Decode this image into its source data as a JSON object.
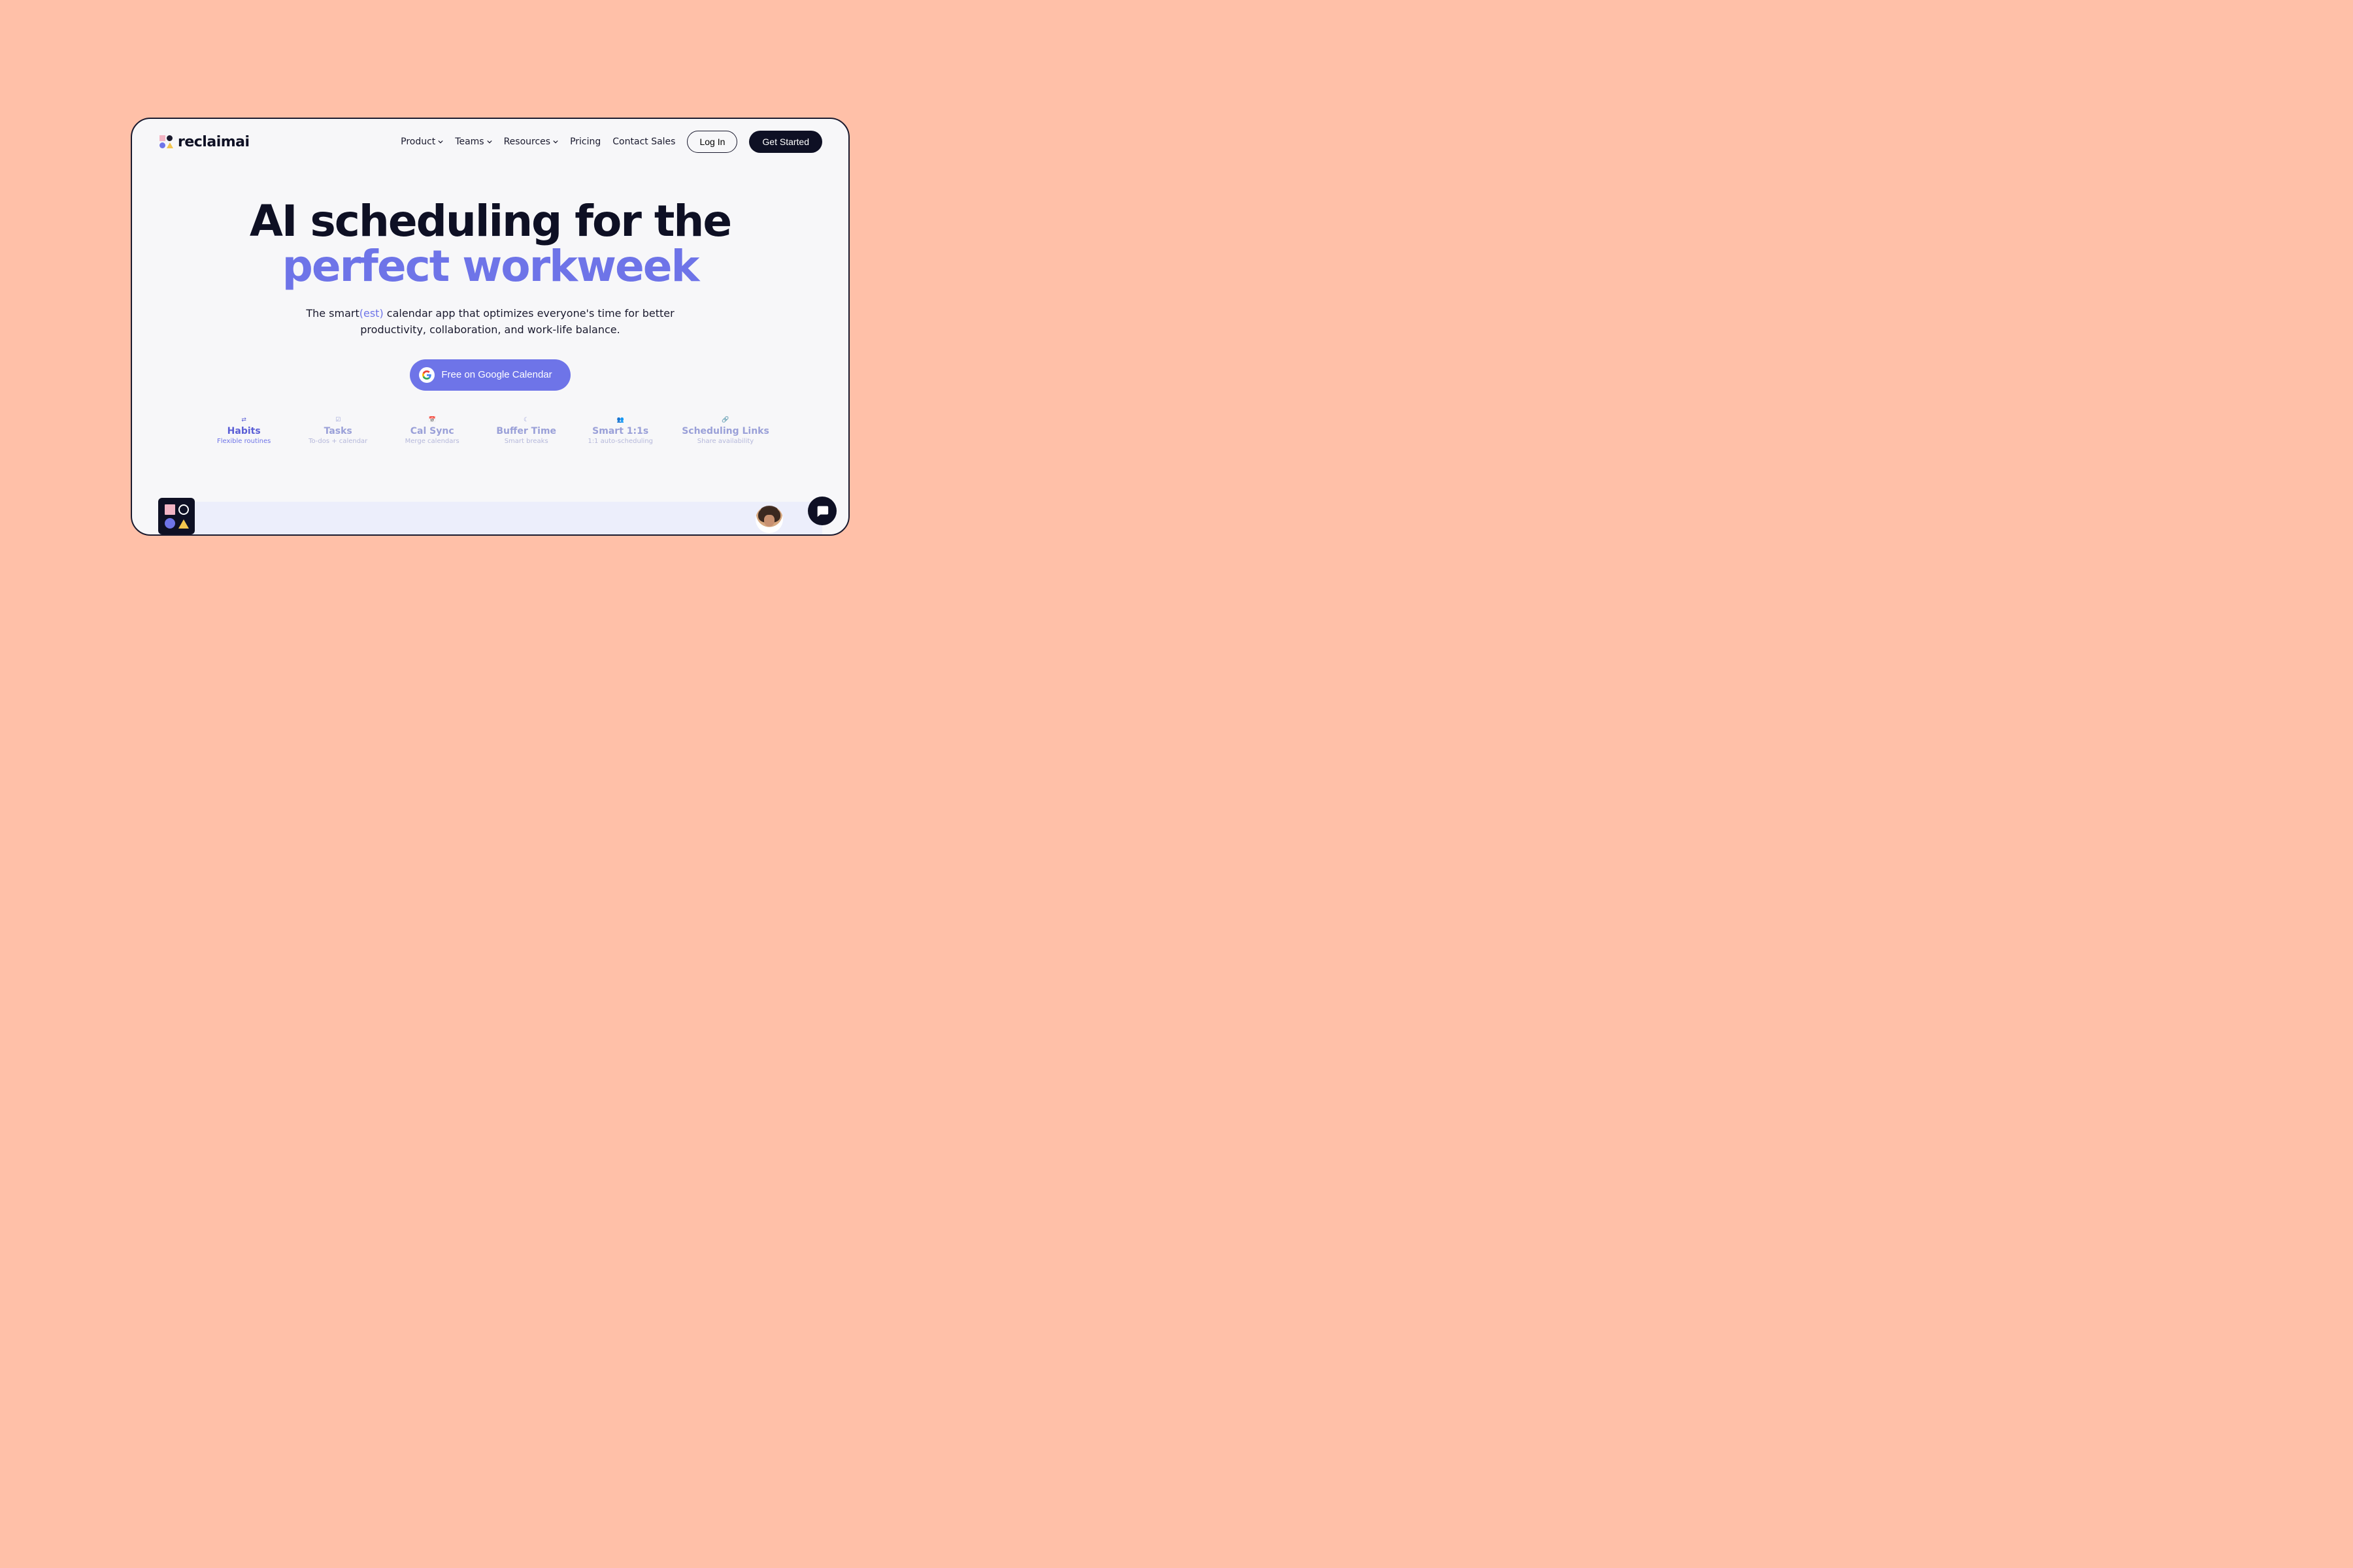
{
  "logo": {
    "text": "reclaimai"
  },
  "nav": {
    "items": [
      {
        "label": "Product",
        "has_dropdown": true
      },
      {
        "label": "Teams",
        "has_dropdown": true
      },
      {
        "label": "Resources",
        "has_dropdown": true
      },
      {
        "label": "Pricing",
        "has_dropdown": false
      },
      {
        "label": "Contact Sales",
        "has_dropdown": false
      }
    ],
    "login": "Log In",
    "get_started": "Get Started"
  },
  "hero": {
    "line1": "AI scheduling for the",
    "line2": "perfect workweek",
    "sub_pre": "The smart",
    "sub_est": "(est)",
    "sub_post": " calendar app that optimizes everyone's time for better",
    "sub_line2": "productivity, collaboration, and work-life balance."
  },
  "cta": {
    "label": "Free on Google Calendar"
  },
  "features": [
    {
      "title": "Habits",
      "sub": "Flexible routines",
      "icon": "repeat-icon",
      "active": true
    },
    {
      "title": "Tasks",
      "sub": "To-dos + calendar",
      "icon": "check-icon",
      "active": false
    },
    {
      "title": "Cal Sync",
      "sub": "Merge calendars",
      "icon": "calendar-icon",
      "active": false
    },
    {
      "title": "Buffer Time",
      "sub": "Smart breaks",
      "icon": "moon-icon",
      "active": false
    },
    {
      "title": "Smart 1:1s",
      "sub": "1:1 auto-scheduling",
      "icon": "people-icon",
      "active": false
    },
    {
      "title": "Scheduling Links",
      "sub": "Share availability",
      "icon": "link-icon",
      "active": false
    }
  ],
  "colors": {
    "accent": "#6E74E8",
    "brand_dark": "#0e1024",
    "page_bg": "#FFC0A8"
  }
}
